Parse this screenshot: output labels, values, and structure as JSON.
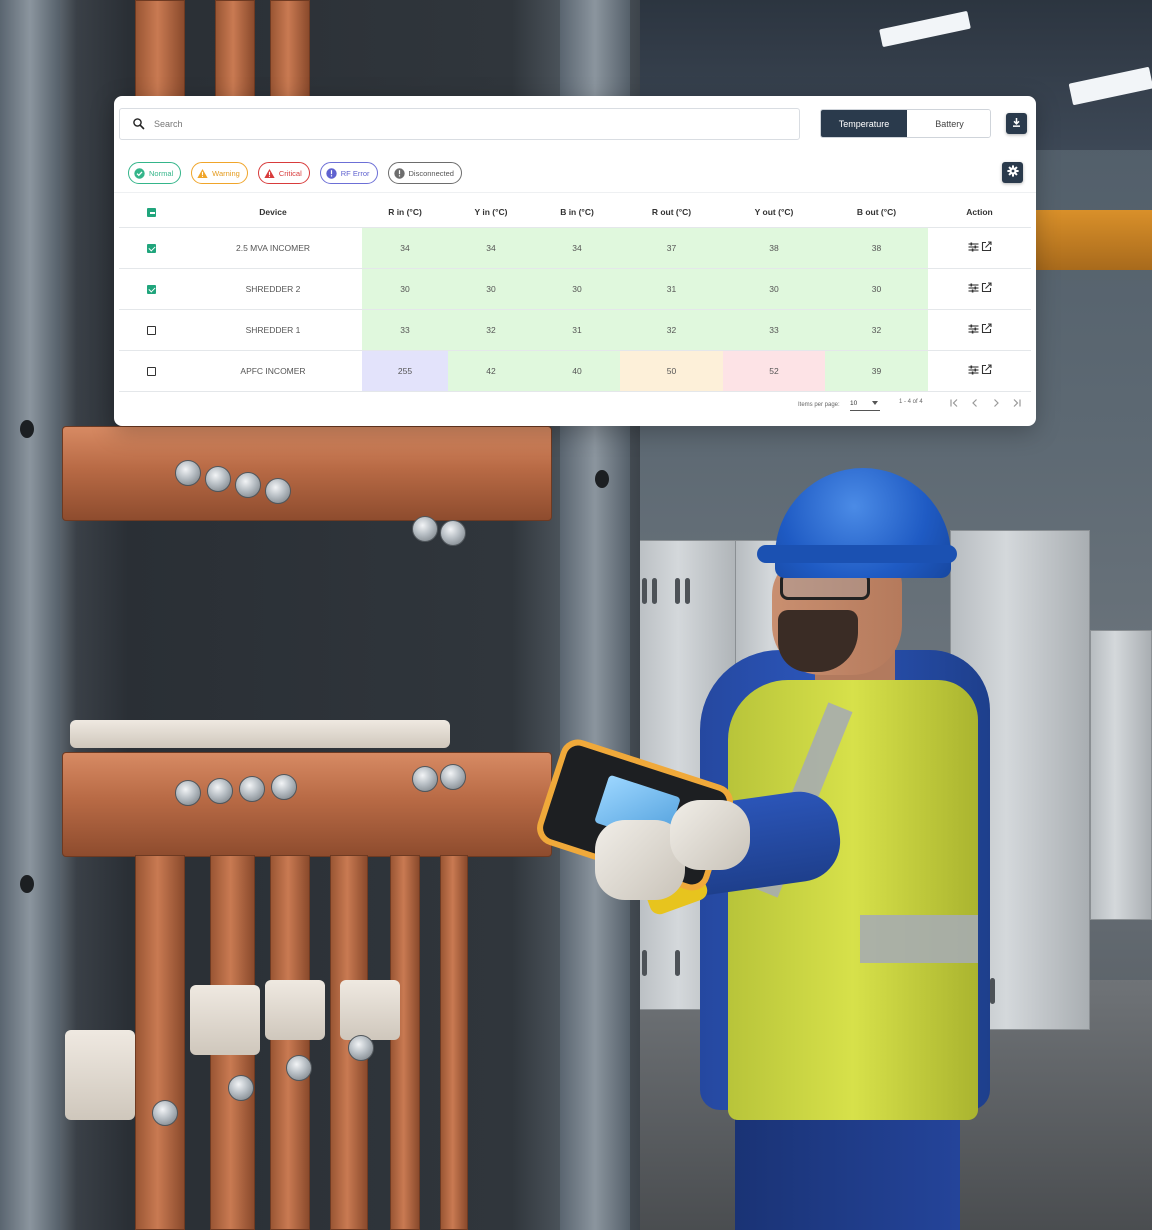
{
  "search": {
    "placeholder": "Search",
    "value": ""
  },
  "metric_toggle": {
    "options": [
      "Temperature",
      "Battery"
    ],
    "selected": "Temperature"
  },
  "icons": {
    "search": "search-icon",
    "download": "download-icon",
    "settings": "gear-icon",
    "action_adjust": "sliders-icon",
    "action_edit": "edit-icon"
  },
  "legend": [
    {
      "label": "Normal",
      "status": "normal",
      "color": "#34b58a"
    },
    {
      "label": "Warning",
      "status": "warning",
      "color": "#f0a52a"
    },
    {
      "label": "Critical",
      "status": "critical",
      "color": "#d83b3b"
    },
    {
      "label": "RF Error",
      "status": "rferror",
      "color": "#6c6fd6"
    },
    {
      "label": "Disconnected",
      "status": "disconnected",
      "color": "#6d6d6d"
    }
  ],
  "table": {
    "header_checkbox": "indeterminate",
    "columns": [
      "Device",
      "R in (°C)",
      "Y in (°C)",
      "B in (°C)",
      "R out (°C)",
      "Y out (°C)",
      "B out (°C)",
      "Action"
    ],
    "rows": [
      {
        "checked": true,
        "device": "2.5 MVA INCOMER",
        "values": [
          "34",
          "34",
          "34",
          "37",
          "38",
          "38"
        ],
        "status": [
          "normal",
          "normal",
          "normal",
          "normal",
          "normal",
          "normal"
        ]
      },
      {
        "checked": true,
        "device": "SHREDDER 2",
        "values": [
          "30",
          "30",
          "30",
          "31",
          "30",
          "30"
        ],
        "status": [
          "normal",
          "normal",
          "normal",
          "normal",
          "normal",
          "normal"
        ]
      },
      {
        "checked": false,
        "device": "SHREDDER 1",
        "values": [
          "33",
          "32",
          "31",
          "32",
          "33",
          "32"
        ],
        "status": [
          "normal",
          "normal",
          "normal",
          "normal",
          "normal",
          "normal"
        ]
      },
      {
        "checked": false,
        "device": "APFC INCOMER",
        "values": [
          "255",
          "42",
          "40",
          "50",
          "52",
          "39"
        ],
        "status": [
          "rferror",
          "normal",
          "normal",
          "warning",
          "critical",
          "normal"
        ]
      }
    ]
  },
  "pagination": {
    "items_per_page_label": "Items per page:",
    "items_per_page": "10",
    "range": "1 - 4 of 4"
  },
  "status_colors": {
    "normal": "#e0f8dd",
    "warning": "#fdf0d9",
    "critical": "#fde3e6",
    "rferror": "#e3e3fb",
    "accent": "#2a3a4c"
  }
}
